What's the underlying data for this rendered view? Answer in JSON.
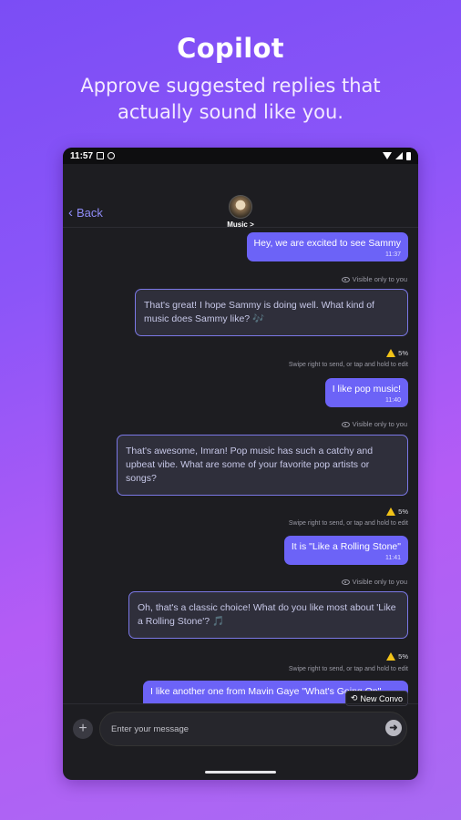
{
  "promo": {
    "title": "Copilot",
    "subtitle_line1": "Approve suggested replies that",
    "subtitle_line2": "actually sound like you."
  },
  "status_bar": {
    "time": "11:57"
  },
  "chat_header": {
    "back_label": "Back",
    "contact_name": "Music >"
  },
  "messages": [
    {
      "type": "sent",
      "text": "Hey, we are excited to see Sammy",
      "time": "11:37",
      "visibility": "Visible only to you"
    },
    {
      "type": "suggestion",
      "text": "That's great! I hope Sammy is doing well. What kind of music does Sammy like? 🎶",
      "confidence": "5%",
      "hint": "Swipe right to send, or tap and hold to edit"
    },
    {
      "type": "sent",
      "text": "I like pop music!",
      "time": "11:40",
      "visibility": "Visible only to you"
    },
    {
      "type": "suggestion",
      "text": "That's awesome, Imran! Pop music has such a catchy and upbeat vibe. What are some of your favorite pop artists or songs?",
      "confidence": "5%",
      "hint": "Swipe right to send, or tap and hold to edit"
    },
    {
      "type": "sent",
      "text": "It is \"Like a Rolling Stone\"",
      "time": "11:41",
      "visibility": "Visible only to you"
    },
    {
      "type": "suggestion",
      "text": "Oh, that's a classic choice! What do you like most about 'Like a Rolling Stone'? 🎵",
      "confidence": "5%",
      "hint": "Swipe right to send, or tap and hold to edit"
    },
    {
      "type": "sent",
      "text": "I like another one from Mavin Gaye \"What's Going On\""
    }
  ],
  "new_convo_label": "New Convo",
  "input": {
    "placeholder": "Enter your message"
  },
  "colors": {
    "accent": "#6c63f7",
    "suggestion_border": "#7b78e6",
    "background_gradient_start": "#7b4df5",
    "background_gradient_end": "#b45cf5",
    "warning": "#f2c318"
  },
  "icons": [
    "back-chevron-icon",
    "eye-icon",
    "warning-icon",
    "plus-icon",
    "send-arrow-icon",
    "refresh-icon"
  ]
}
